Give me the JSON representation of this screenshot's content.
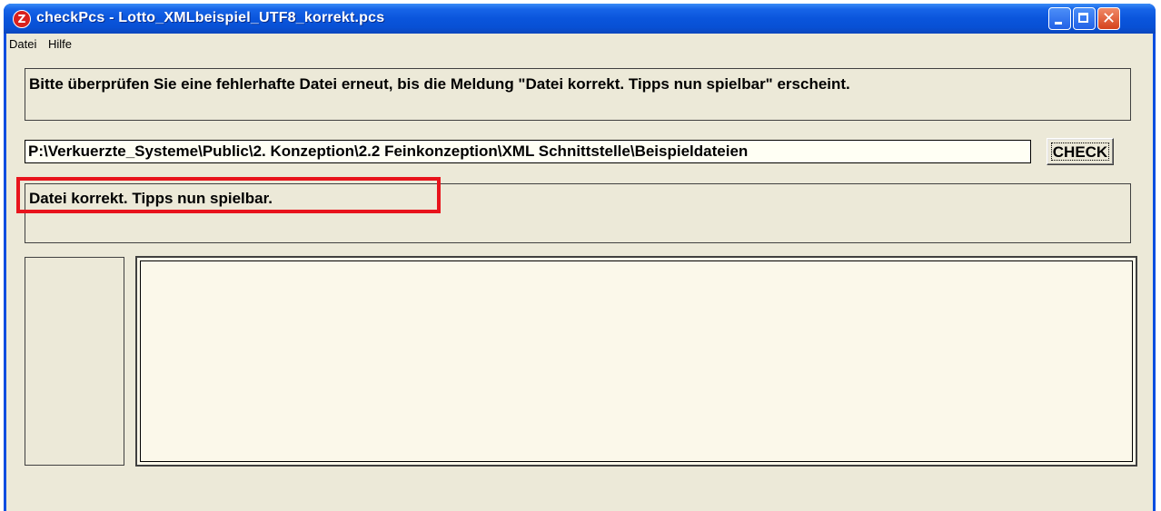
{
  "window": {
    "title": "checkPcs - Lotto_XMLbeispiel_UTF8_korrekt.pcs",
    "icon": "app-logo-icon",
    "icon_glyph": "Z",
    "controls": {
      "close_glyph": "✕"
    }
  },
  "menu": {
    "items": [
      "Datei",
      "Hilfe"
    ]
  },
  "info": {
    "text": "Bitte überprüfen Sie eine fehlerhafte Datei erneut, bis die Meldung \"Datei korrekt. Tipps nun spielbar\" erscheint."
  },
  "path": {
    "value": "P:\\Verkuerzte_Systeme\\Public\\2. Konzeption\\2.2 Feinkonzeption\\XML Schnittstelle\\Beispieldateien"
  },
  "check_button": {
    "label": "CHECK"
  },
  "result": {
    "text": "Datei korrekt. Tipps nun spielbar."
  },
  "colors": {
    "highlight": "#e8141c",
    "titlebar": "#0a55dc",
    "window_bg": "#ece9d8"
  }
}
